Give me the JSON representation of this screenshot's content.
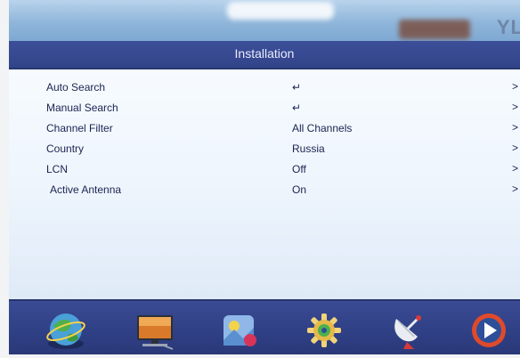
{
  "header": {
    "brand": "YL"
  },
  "title": "Installation",
  "menu": [
    {
      "label": "Auto Search",
      "value": "↵",
      "arrow": ">"
    },
    {
      "label": "Manual Search",
      "value": "↵",
      "arrow": ">"
    },
    {
      "label": "Channel Filter",
      "value": "All Channels",
      "arrow": ">"
    },
    {
      "label": "Country",
      "value": "Russia",
      "arrow": ">"
    },
    {
      "label": "LCN",
      "value": "Off",
      "arrow": ">"
    },
    {
      "label": "Active Antenna",
      "value": "On",
      "arrow": ">"
    }
  ],
  "bottom_icons": [
    "globe-icon",
    "monitor-icon",
    "picture-icon",
    "gear-icon",
    "satellite-dish-icon",
    "play-icon"
  ],
  "colors": {
    "title_bar": "#3c4e98",
    "content_bg": "#eef5fd",
    "text": "#1b2450"
  }
}
